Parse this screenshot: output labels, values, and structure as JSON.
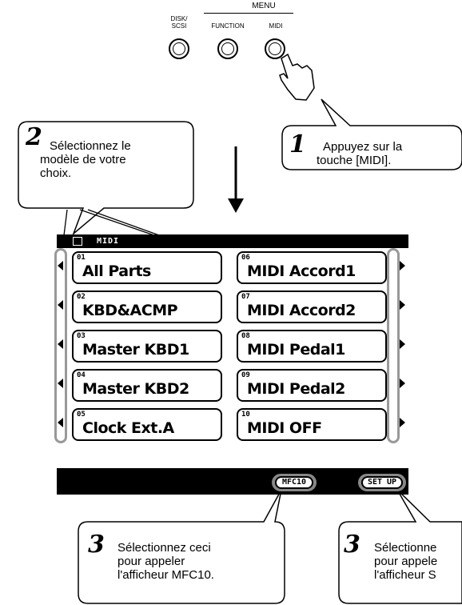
{
  "menu": {
    "title": "MENU",
    "buttons": [
      {
        "label_line1": "DISK/",
        "label_line2": "SCSI"
      },
      {
        "label_line1": "FUNCTION",
        "label_line2": ""
      },
      {
        "label_line1": "MIDI",
        "label_line2": ""
      }
    ]
  },
  "steps": {
    "step1": {
      "number": "1",
      "text_line1": "Appuyez sur la",
      "text_line2": "touche [MIDI]."
    },
    "step2": {
      "number": "2",
      "text_line1": "Sélectionnez le",
      "text_line2": "modèle de votre",
      "text_line3": "choix."
    },
    "step3a": {
      "number": "3",
      "text_line1": "Sélectionnez ceci",
      "text_line2": "pour appeler",
      "text_line3": "l'afficheur MFC10."
    },
    "step3b": {
      "number": "3",
      "text_line1": "Sélectionne",
      "text_line2": "pour appele",
      "text_line3": "l'afficheur S"
    }
  },
  "screen": {
    "title": "MIDI",
    "items_left": [
      {
        "num": "01",
        "name": "All Parts"
      },
      {
        "num": "02",
        "name": "KBD&ACMP"
      },
      {
        "num": "03",
        "name": "Master KBD1"
      },
      {
        "num": "04",
        "name": "Master KBD2"
      },
      {
        "num": "05",
        "name": "Clock Ext.A"
      }
    ],
    "items_right": [
      {
        "num": "06",
        "name": "MIDI Accord1"
      },
      {
        "num": "07",
        "name": "MIDI Accord2"
      },
      {
        "num": "08",
        "name": "MIDI Pedal1"
      },
      {
        "num": "09",
        "name": "MIDI Pedal2"
      },
      {
        "num": "10",
        "name": "MIDI OFF"
      }
    ],
    "bottom_buttons": {
      "mfc10": "MFC10",
      "setup": "SET UP"
    }
  }
}
